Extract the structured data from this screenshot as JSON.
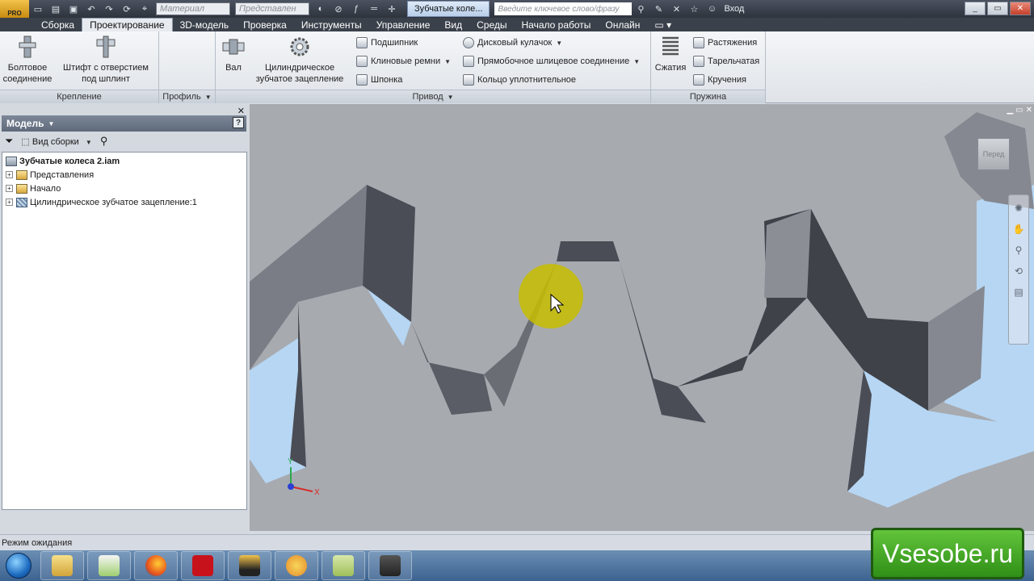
{
  "app": {
    "logo_badge": "PRO",
    "material_combo": "Материал",
    "appearance_combo": "Представлен",
    "document_title": "Зубчатые коле...",
    "search_placeholder": "Введите ключевое слово/фразу",
    "login": "Вход"
  },
  "tabs": [
    {
      "label": "Сборка"
    },
    {
      "label": "Проектирование",
      "active": true
    },
    {
      "label": "3D-модель"
    },
    {
      "label": "Проверка"
    },
    {
      "label": "Инструменты"
    },
    {
      "label": "Управление"
    },
    {
      "label": "Вид"
    },
    {
      "label": "Среды"
    },
    {
      "label": "Начало работы"
    },
    {
      "label": "Онлайн"
    }
  ],
  "ribbon": {
    "fastening": {
      "footer": "Крепление",
      "bolted_line1": "Болтовое",
      "bolted_line2": "соединение",
      "pin_line1": "Штифт с отверстием",
      "pin_line2": "под шплинт"
    },
    "profile": {
      "footer": "Профиль"
    },
    "drive": {
      "footer": "Привод",
      "shaft": "Вал",
      "gear_line1": "Цилиндрическое",
      "gear_line2": "зубчатое зацепление",
      "bearing": "Подшипник",
      "vbelts": "Клиновые ремни",
      "key": "Шпонка",
      "disc_cam": "Дисковый кулачок",
      "spline": "Прямобочное шлицевое соединение",
      "oring": "Кольцо уплотнительное"
    },
    "spring": {
      "footer": "Пружина",
      "compression": "Сжатия",
      "extension": "Растяжения",
      "belleville": "Тарельчатая",
      "torsion": "Кручения"
    }
  },
  "browser": {
    "title": "Модель",
    "view_label": "Вид сборки",
    "help": "?",
    "tree": [
      {
        "label": "Зубчатые колеса 2.iam",
        "root": true
      },
      {
        "label": "Представления"
      },
      {
        "label": "Начало"
      },
      {
        "label": "Цилиндрическое зубчатое зацепление:1"
      }
    ]
  },
  "viewport": {
    "viewcube_face": "Перед",
    "axis_x": "X",
    "axis_y": "Y"
  },
  "status": {
    "text": "Режим ожидания"
  },
  "watermark": "Vsesobe.ru",
  "colors": {
    "ribbon_tab_bar": "#3b414b",
    "viewport_bg": "#a7aaaf",
    "gear_face": "#a9acb1",
    "gear_flank": "#4a4d55",
    "sky_gap": "#b6d6f3",
    "cursor_highlight": "#c7be00",
    "watermark_green": "#3ea21f"
  }
}
